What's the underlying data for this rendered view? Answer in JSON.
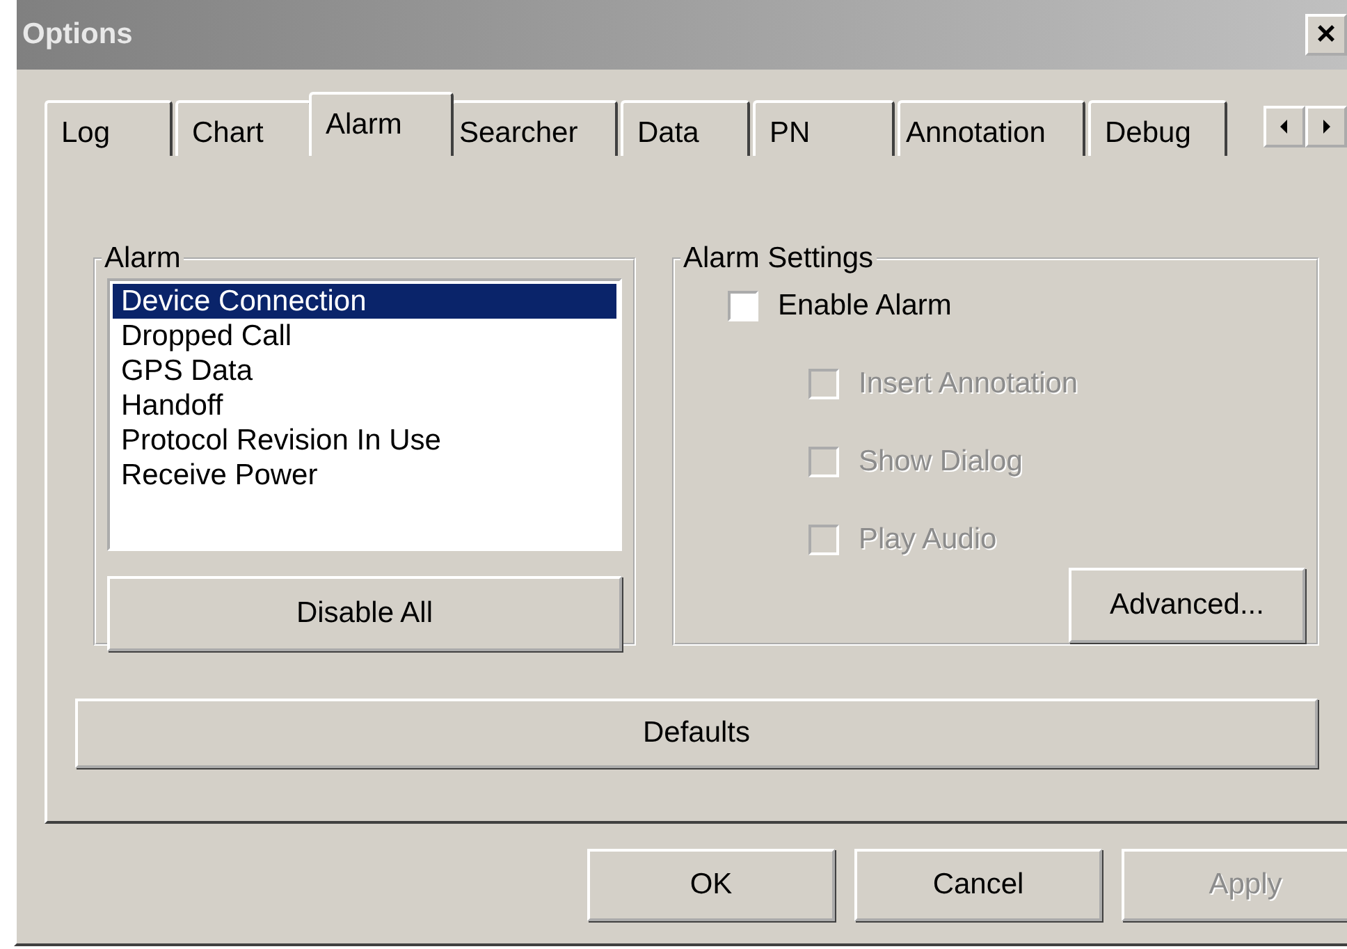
{
  "window": {
    "title": "Options",
    "close": "×"
  },
  "tabs": [
    {
      "label": "Log",
      "selected": false
    },
    {
      "label": "Chart",
      "selected": false
    },
    {
      "label": "Alarm",
      "selected": true
    },
    {
      "label": "Searcher",
      "selected": false
    },
    {
      "label": "Data",
      "selected": false
    },
    {
      "label": "PN",
      "selected": false
    },
    {
      "label": "Annotation",
      "selected": false
    },
    {
      "label": "Debug",
      "selected": false
    }
  ],
  "alarm_group": {
    "title": "Alarm",
    "items": [
      {
        "label": "Device Connection",
        "selected": true
      },
      {
        "label": "Dropped Call",
        "selected": false
      },
      {
        "label": "GPS Data",
        "selected": false
      },
      {
        "label": "Handoff",
        "selected": false
      },
      {
        "label": "Protocol Revision In Use",
        "selected": false
      },
      {
        "label": "Receive Power",
        "selected": false
      }
    ],
    "button": "Disable All"
  },
  "settings_group": {
    "title": "Alarm Settings",
    "checkboxes": [
      {
        "label": "Enable Alarm",
        "checked": false,
        "disabled": false,
        "children": [
          {
            "label": "Insert Annotation",
            "checked": false,
            "disabled": true
          },
          {
            "label": "Show Dialog",
            "checked": false,
            "disabled": true
          },
          {
            "label": "Play Audio",
            "checked": false,
            "disabled": true
          }
        ]
      }
    ],
    "button": "Advanced..."
  },
  "defaults_button": "Defaults",
  "buttons": [
    {
      "label": "OK",
      "disabled": false
    },
    {
      "label": "Cancel",
      "disabled": false
    },
    {
      "label": "Apply",
      "disabled": true
    }
  ]
}
